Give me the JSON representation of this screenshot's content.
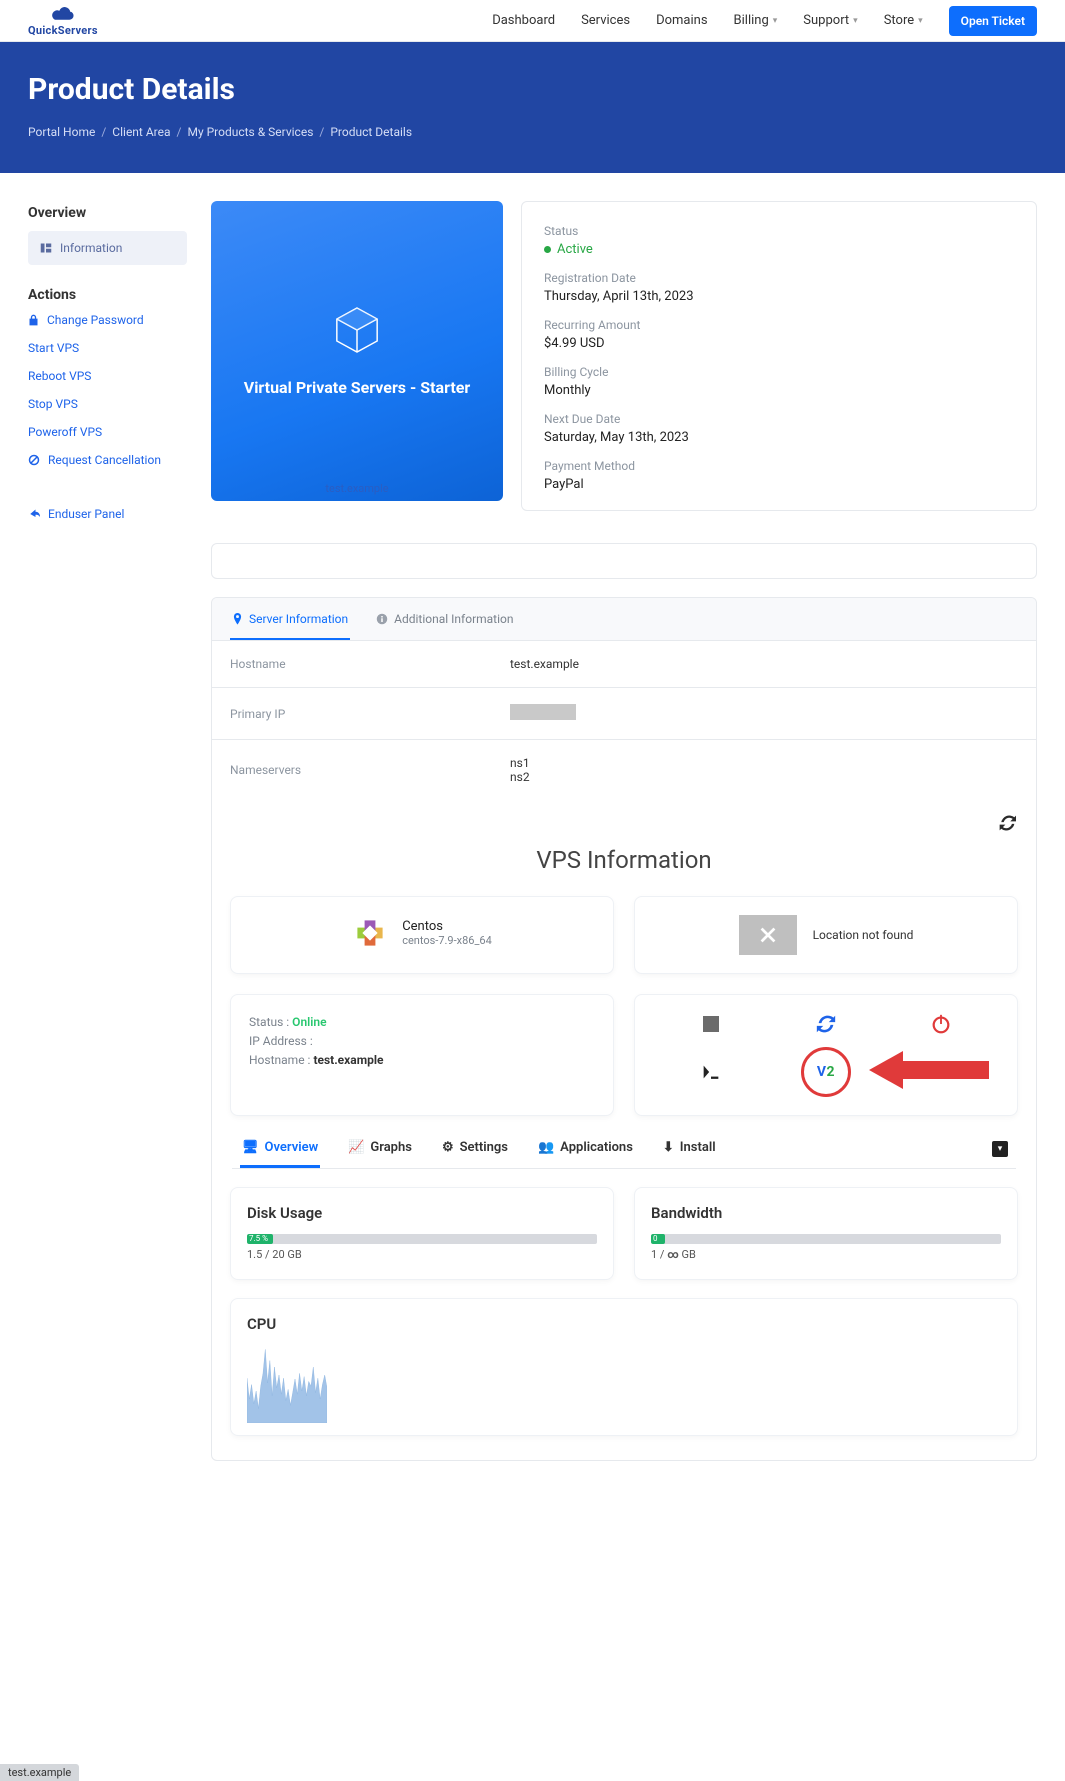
{
  "brand": {
    "name": "QuickServers"
  },
  "nav": {
    "items": [
      {
        "label": "Dashboard",
        "dropdown": false
      },
      {
        "label": "Services",
        "dropdown": false
      },
      {
        "label": "Domains",
        "dropdown": false
      },
      {
        "label": "Billing",
        "dropdown": true
      },
      {
        "label": "Support",
        "dropdown": true
      },
      {
        "label": "Store",
        "dropdown": true
      }
    ],
    "open_ticket": "Open Ticket"
  },
  "hero": {
    "title": "Product Details",
    "crumbs": [
      "Portal Home",
      "Client Area",
      "My Products & Services",
      "Product Details"
    ]
  },
  "sidebar": {
    "overview_title": "Overview",
    "information": "Information",
    "actions_title": "Actions",
    "actions": {
      "change_password": "Change Password",
      "start_vps": "Start VPS",
      "reboot_vps": "Reboot VPS",
      "stop_vps": "Stop VPS",
      "poweroff_vps": "Poweroff VPS",
      "request_cancel": "Request Cancellation"
    },
    "enduser_panel": "Enduser Panel"
  },
  "product_card": {
    "title": "Virtual Private Servers - Starter",
    "footer": "test.example"
  },
  "info": {
    "status_label": "Status",
    "status_value": "Active",
    "reg_label": "Registration Date",
    "reg_value": "Thursday, April 13th, 2023",
    "recur_label": "Recurring Amount",
    "recur_value": "$4.99 USD",
    "cycle_label": "Billing Cycle",
    "cycle_value": "Monthly",
    "due_label": "Next Due Date",
    "due_value": "Saturday, May 13th, 2023",
    "pay_label": "Payment Method",
    "pay_value": "PayPal"
  },
  "panel_tabs": {
    "server_info": "Server Information",
    "additional_info": "Additional Information"
  },
  "panel_rows": {
    "hostname_k": "Hostname",
    "hostname_v": "test.example",
    "primary_ip_k": "Primary IP",
    "ns_k": "Nameservers",
    "ns_v1": "ns1",
    "ns_v2": "ns2"
  },
  "vps": {
    "title": "VPS Information",
    "os_name": "Centos",
    "os_sub": "centos-7.9-x86_64",
    "location_not_found": "Location not found",
    "status_label": "Status : ",
    "status_value": "Online",
    "ip_label": "IP Address :",
    "hostname_label": "Hostname : ",
    "hostname_value": "test.example"
  },
  "ov_tabs": {
    "overview": "Overview",
    "graphs": "Graphs",
    "settings": "Settings",
    "apps": "Applications",
    "install": "Install"
  },
  "usage": {
    "disk_title": "Disk Usage",
    "disk_pct_label": "7.5 %",
    "disk_pct": 7.5,
    "disk_meta_used": "1.5",
    "disk_meta_total": "20 GB",
    "bw_title": "Bandwidth",
    "bw_pct_label": "0 %",
    "bw_pct": 2,
    "bw_meta_used": "1",
    "bw_meta_total_inf": "∞",
    "bw_meta_unit": "GB"
  },
  "cpu": {
    "title": "CPU"
  },
  "footer_tab": "test.example",
  "chart_data": {
    "type": "area",
    "title": "CPU",
    "xlabel": "",
    "ylabel": "",
    "x": [
      0,
      1,
      2,
      3,
      4,
      5,
      6,
      7,
      8,
      9,
      10,
      11,
      12,
      13,
      14,
      15,
      16,
      17,
      18,
      19,
      20,
      21,
      22,
      23,
      24,
      25,
      26,
      27,
      28,
      29,
      30,
      31,
      32,
      33,
      34,
      35
    ],
    "values": [
      56,
      30,
      48,
      24,
      40,
      18,
      46,
      62,
      92,
      50,
      78,
      34,
      70,
      44,
      60,
      36,
      56,
      28,
      42,
      22,
      38,
      55,
      36,
      62,
      40,
      58,
      34,
      52,
      46,
      70,
      38,
      56,
      30,
      48,
      60,
      44
    ],
    "ylim": [
      0,
      100
    ]
  }
}
